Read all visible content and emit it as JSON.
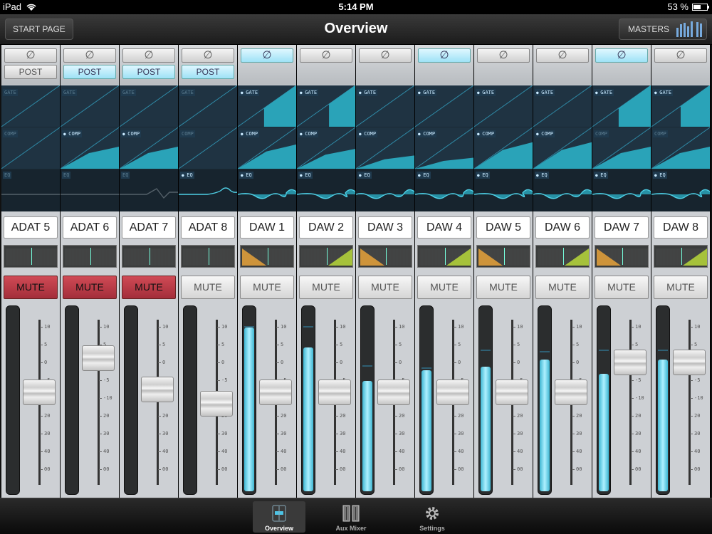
{
  "status_bar": {
    "device": "iPad",
    "time": "5:14 PM",
    "battery": "53 %"
  },
  "header": {
    "title": "Overview",
    "start_page_label": "START PAGE",
    "masters_label": "MASTERS"
  },
  "phase_symbol": "∅",
  "fader_scale": [
    "10",
    "5",
    "0",
    "-5",
    "-10",
    "20",
    "30",
    "40",
    "00"
  ],
  "channels": [
    {
      "name": "ADAT 5",
      "post": "POST",
      "post_shown": true,
      "post_on": false,
      "phase_on": false,
      "gate_on": false,
      "comp_on": false,
      "eq_on": false,
      "gate_thresh": 0,
      "comp_ratio": 0,
      "eq_shape": "flat",
      "pan": "center",
      "mute": "MUTE",
      "muted": true,
      "meter_level": 0,
      "meter_peak": 0,
      "fader_position": 0.58
    },
    {
      "name": "ADAT 6",
      "post": "POST",
      "post_shown": true,
      "post_on": true,
      "phase_on": false,
      "gate_on": false,
      "comp_on": true,
      "eq_on": false,
      "gate_thresh": 0,
      "comp_ratio": 0.5,
      "eq_shape": "flat",
      "pan": "center",
      "mute": "MUTE",
      "muted": true,
      "meter_level": 0,
      "meter_peak": 0,
      "fader_position": 0.82
    },
    {
      "name": "ADAT 7",
      "post": "POST",
      "post_shown": true,
      "post_on": true,
      "phase_on": false,
      "gate_on": false,
      "comp_on": true,
      "eq_on": false,
      "gate_thresh": 0,
      "comp_ratio": 0.5,
      "eq_shape": "notch",
      "pan": "center",
      "mute": "MUTE",
      "muted": true,
      "meter_level": 0,
      "meter_peak": 0,
      "fader_position": 0.6
    },
    {
      "name": "ADAT 8",
      "post": "POST",
      "post_shown": true,
      "post_on": true,
      "phase_on": false,
      "gate_on": false,
      "comp_on": false,
      "eq_on": true,
      "gate_thresh": 0,
      "comp_ratio": 0,
      "eq_shape": "bump",
      "pan": "center",
      "mute": "MUTE",
      "muted": false,
      "meter_level": 0,
      "meter_peak": 0,
      "fader_position": 0.5
    },
    {
      "name": "DAW 1",
      "post": "",
      "post_shown": false,
      "post_on": false,
      "phase_on": true,
      "gate_on": true,
      "comp_on": true,
      "eq_on": true,
      "gate_thresh": 0.45,
      "comp_ratio": 0.55,
      "eq_shape": "wave",
      "pan": "left",
      "mute": "MUTE",
      "muted": false,
      "meter_level": 0.92,
      "meter_peak": 0.92,
      "fader_position": 0.58
    },
    {
      "name": "DAW 2",
      "post": "",
      "post_shown": false,
      "post_on": false,
      "phase_on": false,
      "gate_on": true,
      "comp_on": true,
      "eq_on": true,
      "gate_thresh": 0.55,
      "comp_ratio": 0.45,
      "eq_shape": "wave",
      "pan": "right",
      "mute": "MUTE",
      "muted": false,
      "meter_level": 0.81,
      "meter_peak": 0.92,
      "fader_position": 0.58
    },
    {
      "name": "DAW 3",
      "post": "",
      "post_shown": false,
      "post_on": false,
      "phase_on": false,
      "gate_on": true,
      "comp_on": true,
      "eq_on": true,
      "gate_thresh": 0,
      "comp_ratio": 0.3,
      "eq_shape": "wave",
      "pan": "left",
      "mute": "MUTE",
      "muted": false,
      "meter_level": 0.62,
      "meter_peak": 0.7,
      "fader_position": 0.58
    },
    {
      "name": "DAW 4",
      "post": "",
      "post_shown": false,
      "post_on": false,
      "phase_on": true,
      "gate_on": true,
      "comp_on": true,
      "eq_on": true,
      "gate_thresh": 0,
      "comp_ratio": 0.25,
      "eq_shape": "wave",
      "pan": "right",
      "mute": "MUTE",
      "muted": false,
      "meter_level": 0.68,
      "meter_peak": 0.69,
      "fader_position": 0.58
    },
    {
      "name": "DAW 5",
      "post": "",
      "post_shown": false,
      "post_on": false,
      "phase_on": false,
      "gate_on": true,
      "comp_on": true,
      "eq_on": true,
      "gate_thresh": 0,
      "comp_ratio": 0.6,
      "eq_shape": "wave",
      "pan": "left",
      "mute": "MUTE",
      "muted": false,
      "meter_level": 0.7,
      "meter_peak": 0.79,
      "fader_position": 0.58
    },
    {
      "name": "DAW 6",
      "post": "",
      "post_shown": false,
      "post_on": false,
      "phase_on": false,
      "gate_on": true,
      "comp_on": true,
      "eq_on": true,
      "gate_thresh": 0,
      "comp_ratio": 0.6,
      "eq_shape": "wave",
      "pan": "right",
      "mute": "MUTE",
      "muted": false,
      "meter_level": 0.74,
      "meter_peak": 0.78,
      "fader_position": 0.58
    },
    {
      "name": "DAW 7",
      "post": "",
      "post_shown": false,
      "post_on": false,
      "phase_on": true,
      "gate_on": true,
      "comp_on": false,
      "eq_on": true,
      "gate_thresh": 0.45,
      "comp_ratio": 0.5,
      "eq_shape": "wave",
      "pan": "left",
      "mute": "MUTE",
      "muted": false,
      "meter_level": 0.66,
      "meter_peak": 0.79,
      "fader_position": 0.79
    },
    {
      "name": "DAW 8",
      "post": "",
      "post_shown": false,
      "post_on": false,
      "phase_on": false,
      "gate_on": true,
      "comp_on": false,
      "eq_on": true,
      "gate_thresh": 0.5,
      "comp_ratio": 0.5,
      "eq_shape": "wave",
      "pan": "right",
      "mute": "MUTE",
      "muted": false,
      "meter_level": 0.74,
      "meter_peak": 0.79,
      "fader_position": 0.79
    }
  ],
  "dyn_labels": {
    "gate": "GATE",
    "comp": "COMP",
    "eq": "EQ"
  },
  "tabs": [
    {
      "label": "Overview",
      "icon": "overview-icon",
      "selected": true
    },
    {
      "label": "Aux Mixer",
      "icon": "aux-mixer-icon",
      "selected": false
    },
    {
      "label": "Settings",
      "icon": "gear-icon",
      "selected": false
    }
  ],
  "colors": {
    "accent": "#3fb7d3",
    "mute_on": "#c0404c",
    "post_on": "#9ee2f6",
    "pan_left": "#e8a23a",
    "pan_right": "#b8d83a"
  }
}
